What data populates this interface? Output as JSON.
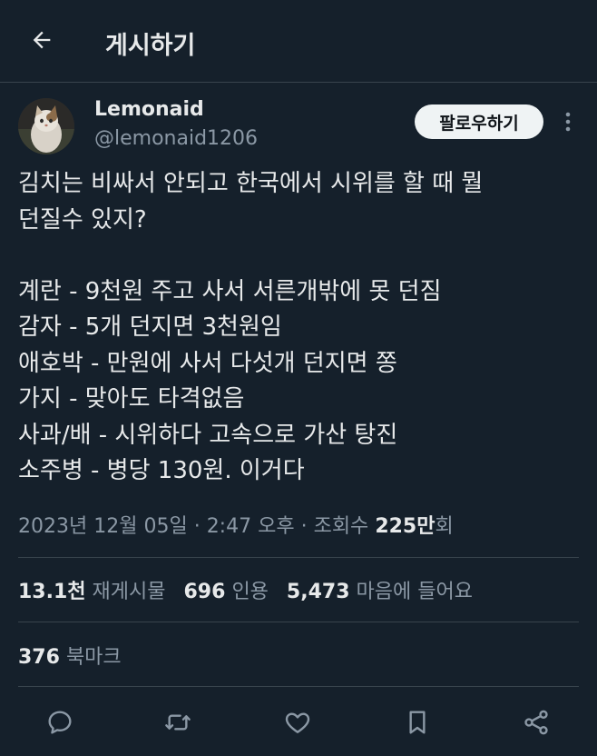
{
  "header": {
    "title": "게시하기",
    "back_icon": "arrow-left-icon"
  },
  "author": {
    "name": "Lemonaid",
    "handle": "@lemonaid1206"
  },
  "follow_label": "팔로우하기",
  "body_lines": [
    "김치는 비싸서 안되고 한국에서 시위를 할 때 뭘",
    "던질수 있지?",
    "",
    "계란 - 9천원 주고 사서 서른개밖에 못 던짐",
    "감자 - 5개 던지면 3천원임",
    "애호박 - 만원에 사서 다섯개 던지면 쫑",
    "가지 - 맞아도 타격없음",
    "사과/배 - 시위하다 고속으로 가산 탕진",
    "소주병 - 병당 130원. 이거다"
  ],
  "meta": {
    "date": "2023년 12월 05일",
    "sep1": "·",
    "time": "2:47 오후",
    "sep2": "·",
    "views_label": "조회수",
    "views_value": "225만",
    "views_suffix": "회"
  },
  "stats": {
    "retweets_value": "13.1천",
    "retweets_label": "재게시물",
    "quotes_value": "696",
    "quotes_label": "인용",
    "likes_value": "5,473",
    "likes_label": "마음에 들어요"
  },
  "bookmarks": {
    "value": "376",
    "label": "북마크"
  },
  "colors": {
    "background": "#15202b",
    "text": "#e7e9ea",
    "muted": "#8b98a5",
    "divider": "#38444d",
    "follow_bg": "#eff3f4"
  },
  "icons": {
    "reply": "reply-icon",
    "retweet": "retweet-icon",
    "like": "heart-icon",
    "bookmark": "bookmark-icon",
    "share": "share-icon",
    "more": "more-vertical-icon"
  }
}
